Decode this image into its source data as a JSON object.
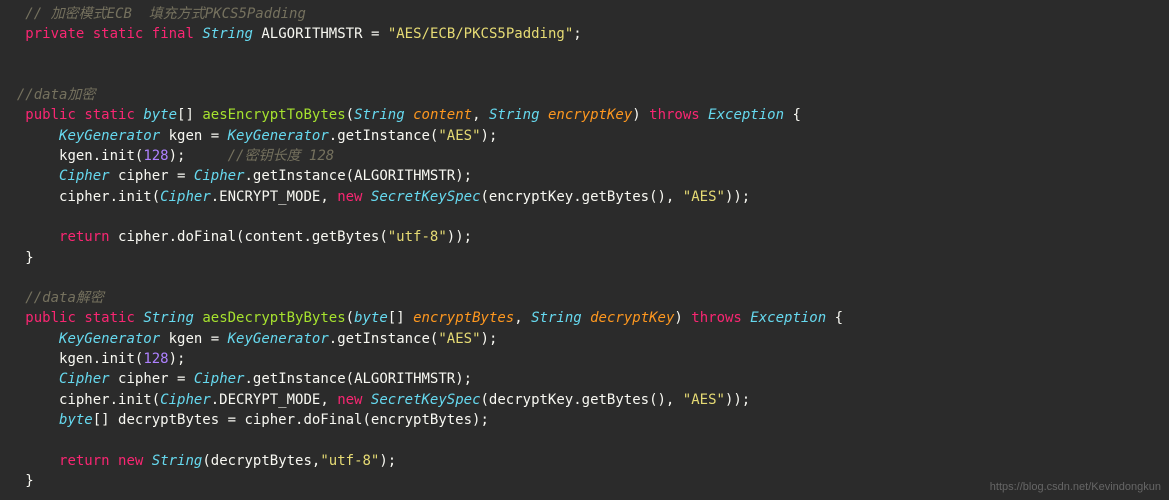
{
  "watermark": "https://blog.csdn.net/Kevindongkun",
  "code": {
    "l1_comment": "// 加密模式ECB  填充方式PKCS5Padding",
    "l2_kw1": "private",
    "l2_kw2": "static",
    "l2_kw3": "final",
    "l2_type": "String",
    "l2_name": "ALGORITHMSTR",
    "l2_eq": " = ",
    "l2_str": "\"AES/ECB/PKCS5Padding\"",
    "l2_semi": ";",
    "l4_comment": "//data加密",
    "l5_kw1": "public",
    "l5_kw2": "static",
    "l5_type": "byte",
    "l5_br": "[]",
    "l5_fn": "aesEncryptToBytes",
    "l5_p1t": "String",
    "l5_p1n": "content",
    "l5_p2t": "String",
    "l5_p2n": "encryptKey",
    "l5_throws": "throws",
    "l5_ex": "Exception",
    "l5_ob": " {",
    "l6_t": "KeyGenerator",
    "l6_v": "kgen",
    "l6_eq": " = ",
    "l6_t2": "KeyGenerator",
    "l6_m": ".getInstance(",
    "l6_s": "\"AES\"",
    "l6_e": ");",
    "l7_a": "kgen.init(",
    "l7_n": "128",
    "l7_b": ");",
    "l7_c": "//密钥长度 128",
    "l8_t": "Cipher",
    "l8_v": "cipher",
    "l8_eq": " = ",
    "l8_t2": "Cipher",
    "l8_m": ".getInstance(",
    "l8_arg": "ALGORITHMSTR",
    "l8_e": ");",
    "l9_a": "cipher.init(",
    "l9_t": "Cipher",
    "l9_f": ".ENCRYPT_MODE",
    "l9_c": ", ",
    "l9_new": "new",
    "l9_t2": "SecretKeySpec",
    "l9_o": "(encryptKey.getBytes(), ",
    "l9_s": "\"AES\"",
    "l9_e": "));",
    "l11_ret": "return",
    "l11_a": " cipher.doFinal(content.getBytes(",
    "l11_s": "\"utf-8\"",
    "l11_e": "));",
    "l12_cb": "}",
    "l14_comment": "//data解密",
    "l15_kw1": "public",
    "l15_kw2": "static",
    "l15_type": "String",
    "l15_fn": "aesDecryptByBytes",
    "l15_p1t": "byte",
    "l15_p1b": "[]",
    "l15_p1n": "encryptBytes",
    "l15_p2t": "String",
    "l15_p2n": "decryptKey",
    "l15_throws": "throws",
    "l15_ex": "Exception",
    "l15_ob": " {",
    "l16_t": "KeyGenerator",
    "l16_v": "kgen",
    "l16_eq": " = ",
    "l16_t2": "KeyGenerator",
    "l16_m": ".getInstance(",
    "l16_s": "\"AES\"",
    "l16_e": ");",
    "l17_a": "kgen.init(",
    "l17_n": "128",
    "l17_b": ");",
    "l18_t": "Cipher",
    "l18_v": "cipher",
    "l18_eq": " = ",
    "l18_t2": "Cipher",
    "l18_m": ".getInstance(",
    "l18_arg": "ALGORITHMSTR",
    "l18_e": ");",
    "l19_a": "cipher.init(",
    "l19_t": "Cipher",
    "l19_f": ".DECRYPT_MODE",
    "l19_c": ", ",
    "l19_new": "new",
    "l19_t2": "SecretKeySpec",
    "l19_o": "(decryptKey.getBytes(), ",
    "l19_s": "\"AES\"",
    "l19_e": "));",
    "l20_t": "byte",
    "l20_b": "[]",
    "l20_v": " decryptBytes = cipher.doFinal(encryptBytes);",
    "l22_ret": "return",
    "l22_new": "new",
    "l22_t": "String",
    "l22_a": "(decryptBytes,",
    "l22_s": "\"utf-8\"",
    "l22_e": ");",
    "l23_cb": "}"
  }
}
